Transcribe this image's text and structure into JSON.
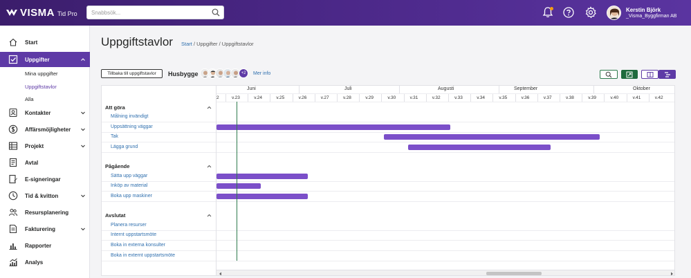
{
  "header": {
    "logo": "VISMA",
    "product": "Tid Pro",
    "search_placeholder": "Snabbsök...",
    "user_name": "Kerstin Björk",
    "user_company": "_Visma_Byggfirman AB"
  },
  "sidebar": {
    "items": [
      {
        "label": "Start"
      },
      {
        "label": "Uppgifter"
      },
      {
        "label": "Kontakter"
      },
      {
        "label": "Affärsmöjligheter"
      },
      {
        "label": "Projekt"
      },
      {
        "label": "Avtal"
      },
      {
        "label": "E-signeringar"
      },
      {
        "label": "Tid & kvitton"
      },
      {
        "label": "Resursplanering"
      },
      {
        "label": "Fakturering"
      },
      {
        "label": "Rapporter"
      },
      {
        "label": "Analys"
      }
    ],
    "subitems": [
      {
        "label": "Mina uppgifter"
      },
      {
        "label": "Uppgiftstavlor"
      },
      {
        "label": "Alla"
      }
    ]
  },
  "page": {
    "title": "Uppgiftstavlor",
    "breadcrumb_start": "Start",
    "breadcrumb_rest": " / Uppgifter / Uppgiftstavlor",
    "back_button": "Tillbaka till uppgiftstavlor",
    "board_name": "Husbygge",
    "members_more": "+2",
    "more_info": "Mer info"
  },
  "timeline": {
    "months": [
      "Juni",
      "Juli",
      "Augusti",
      "September",
      "Oktober"
    ],
    "weeks": [
      "2",
      "v.23",
      "v.24",
      "v.25",
      "v.26",
      "v.27",
      "v.28",
      "v.29",
      "v.30",
      "v.31",
      "v.32",
      "v.33",
      "v.34",
      "v.35",
      "v.36",
      "v.37",
      "v.38",
      "v.39",
      "v.40",
      "v.41",
      "v.42"
    ]
  },
  "groups": [
    {
      "title": "Att göra",
      "tasks": [
        {
          "name": "Målning invändigt",
          "start": null,
          "end": null
        },
        {
          "name": "Uppsättning väggar",
          "start": 0,
          "end": 10.5
        },
        {
          "name": "Tak",
          "start": 7.5,
          "end": 17.2
        },
        {
          "name": "Lägga grund",
          "start": 8.6,
          "end": 15.0
        }
      ]
    },
    {
      "title": "Pågående",
      "tasks": [
        {
          "name": "Sätta upp väggar",
          "start": 0,
          "end": 4.1
        },
        {
          "name": "Inköp av material",
          "start": 0,
          "end": 2.0
        },
        {
          "name": "Boka upp maskiner",
          "start": 0,
          "end": 4.1
        }
      ]
    },
    {
      "title": "Avslutat",
      "tasks": [
        {
          "name": "Planera resurser",
          "start": null,
          "end": null
        },
        {
          "name": "Internt uppstartsmöte",
          "start": null,
          "end": null
        },
        {
          "name": "Boka in externa konsulter",
          "start": null,
          "end": null
        },
        {
          "name": "Boka in externt uppstartsmöte",
          "start": null,
          "end": null
        }
      ]
    }
  ],
  "colors": {
    "brand": "#4a2786",
    "accent": "#5e3aa6",
    "bar": "#7b4fc9",
    "today_line": "#2c7a4b",
    "link": "#2f6fae"
  }
}
